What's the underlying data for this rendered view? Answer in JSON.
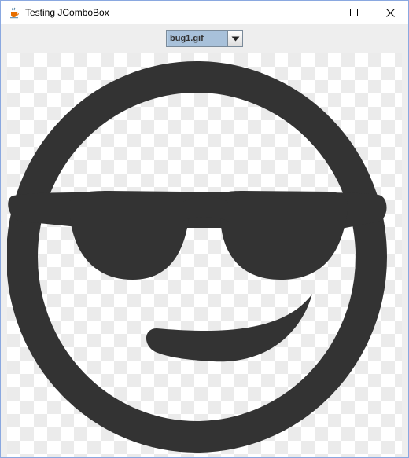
{
  "window": {
    "title": "Testing JComboBox",
    "app_icon": "java-coffee-cup-icon",
    "controls": [
      "minimize-icon",
      "maximize-icon",
      "close-icon"
    ]
  },
  "combo_box": {
    "selected": "bug1.gif",
    "arrow_icon": "chevron-down-icon"
  },
  "image": {
    "content": "smiley-sunglasses-icon",
    "colors": {
      "ink": "#333333",
      "checker_light": "#ffffff",
      "checker_dark": "#ebebeb"
    }
  }
}
